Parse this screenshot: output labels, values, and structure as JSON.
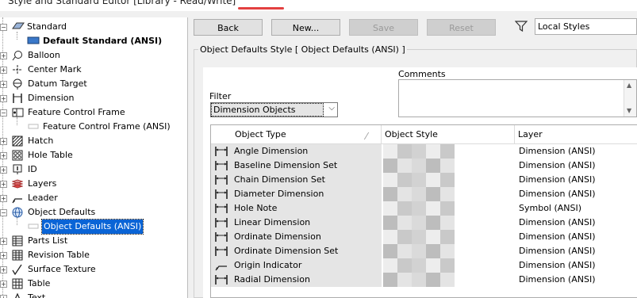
{
  "window": {
    "title": "Style and Standard Editor [Library - Read/Write]"
  },
  "tree": [
    {
      "label": "Standard",
      "icon": "standard-icon",
      "expand": "−",
      "level": 0
    },
    {
      "label": "Default Standard (ANSI)",
      "icon": "standard-item-icon",
      "level": 1,
      "bold": true
    },
    {
      "label": "Balloon",
      "icon": "balloon-icon",
      "expand": "+",
      "level": 0
    },
    {
      "label": "Center Mark",
      "icon": "center-mark-icon",
      "expand": "+",
      "level": 0
    },
    {
      "label": "Datum Target",
      "icon": "datum-target-icon",
      "expand": "+",
      "level": 0
    },
    {
      "label": "Dimension",
      "icon": "dimension-icon",
      "expand": "+",
      "level": 0
    },
    {
      "label": "Feature Control Frame",
      "icon": "feature-control-frame-icon",
      "expand": "−",
      "level": 0
    },
    {
      "label": "Feature Control Frame (ANSI)",
      "icon": "style-item-icon",
      "level": 1
    },
    {
      "label": "Hatch",
      "icon": "hatch-icon",
      "expand": "+",
      "level": 0
    },
    {
      "label": "Hole Table",
      "icon": "hole-table-icon",
      "expand": "+",
      "level": 0
    },
    {
      "label": "ID",
      "icon": "id-icon",
      "expand": "+",
      "level": 0
    },
    {
      "label": "Layers",
      "icon": "layers-icon",
      "expand": "+",
      "level": 0
    },
    {
      "label": "Leader",
      "icon": "leader-icon",
      "expand": "+",
      "level": 0
    },
    {
      "label": "Object Defaults",
      "icon": "object-defaults-icon",
      "expand": "−",
      "level": 0
    },
    {
      "label": "Object Defaults (ANSI)",
      "icon": "style-item-icon",
      "level": 1,
      "selected": true
    },
    {
      "label": "Parts List",
      "icon": "parts-list-icon",
      "expand": "+",
      "level": 0
    },
    {
      "label": "Revision Table",
      "icon": "revision-table-icon",
      "expand": "+",
      "level": 0
    },
    {
      "label": "Surface Texture",
      "icon": "surface-texture-icon",
      "expand": "+",
      "level": 0
    },
    {
      "label": "Table",
      "icon": "table-icon",
      "expand": "+",
      "level": 0
    },
    {
      "label": "Text",
      "icon": "text-icon",
      "expand": "+",
      "level": 0
    }
  ],
  "toolbar": {
    "back": "Back",
    "new": "New...",
    "save": "Save",
    "reset": "Reset",
    "style_source": "Local Styles"
  },
  "panel": {
    "title": "Object Defaults Style [ Object Defaults (ANSI) ]",
    "comments_label": "Comments",
    "comments_value": "",
    "filter_label": "Filter",
    "filter_value": "Dimension Objects"
  },
  "table": {
    "headers": {
      "type": "Object Type",
      "style": "Object Style",
      "layer": "Layer"
    },
    "rows": [
      {
        "type": "Angle Dimension",
        "icon": "dimension-icon",
        "layer": "Dimension (ANSI)"
      },
      {
        "type": "Baseline Dimension Set",
        "icon": "dimension-icon",
        "layer": "Dimension (ANSI)"
      },
      {
        "type": "Chain Dimension Set",
        "icon": "dimension-icon",
        "layer": "Dimension (ANSI)"
      },
      {
        "type": "Diameter Dimension",
        "icon": "dimension-icon",
        "layer": "Dimension (ANSI)"
      },
      {
        "type": "Hole Note",
        "icon": "dimension-icon",
        "layer": "Symbol (ANSI)"
      },
      {
        "type": "Linear Dimension",
        "icon": "dimension-icon",
        "layer": "Dimension (ANSI)"
      },
      {
        "type": "Ordinate Dimension",
        "icon": "dimension-icon",
        "layer": "Dimension (ANSI)"
      },
      {
        "type": "Ordinate Dimension Set",
        "icon": "dimension-icon",
        "layer": "Dimension (ANSI)"
      },
      {
        "type": "Origin Indicator",
        "icon": "origin-indicator-icon",
        "layer": "Dimension (ANSI)"
      },
      {
        "type": "Radial Dimension",
        "icon": "dimension-icon",
        "layer": "Dimension (ANSI)"
      }
    ]
  },
  "colors": {
    "selection": "#0a64d6",
    "window_bg": "#f0f0f0",
    "row_shade": "#e5e5e5"
  }
}
